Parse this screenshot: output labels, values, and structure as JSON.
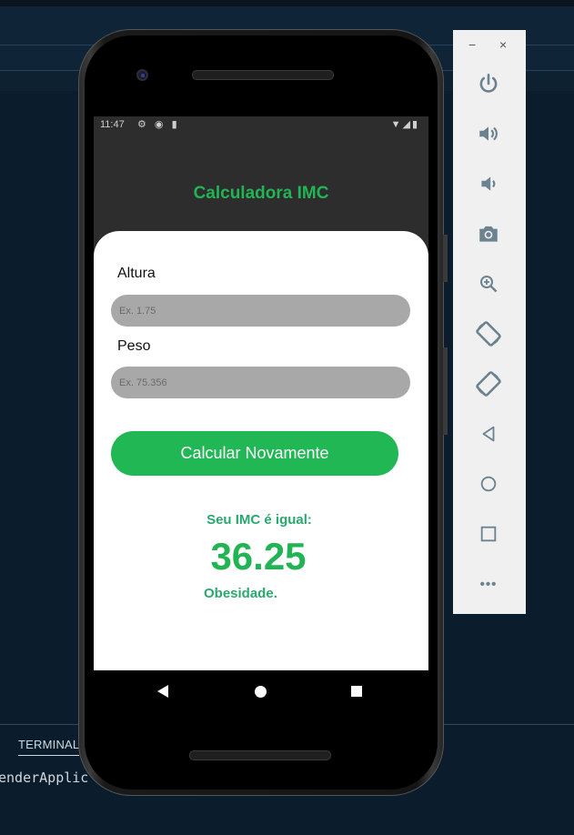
{
  "ide": {
    "terminal_tab": "TERMINAL",
    "terminal_output": "enderApplic"
  },
  "status_bar": {
    "time": "11:47",
    "left_icons": "⚙ ◉ ▮",
    "right_icons": "▼◢▮"
  },
  "app": {
    "title": "Calculadora IMC",
    "height_label": "Altura",
    "height_placeholder": "Ex. 1.75",
    "weight_label": "Peso",
    "weight_placeholder": "Ex. 75.356",
    "button_label": "Calcular Novamente",
    "result_label": "Seu IMC é igual:",
    "result_value": "36.25",
    "result_classification": "Obesidade."
  },
  "colors": {
    "accent_green": "#21b755",
    "result_text_green": "#2aa86e",
    "screen_background": "#2d2d2d"
  },
  "emulator_toolbar": {
    "minimize": "−",
    "close": "×",
    "tools": [
      "power-icon",
      "volume-up-icon",
      "volume-down-icon",
      "camera-icon",
      "zoom-in-icon",
      "rotate-left-icon",
      "rotate-right-icon",
      "back-icon",
      "home-icon",
      "overview-icon",
      "more-icon"
    ],
    "more": "•••"
  }
}
